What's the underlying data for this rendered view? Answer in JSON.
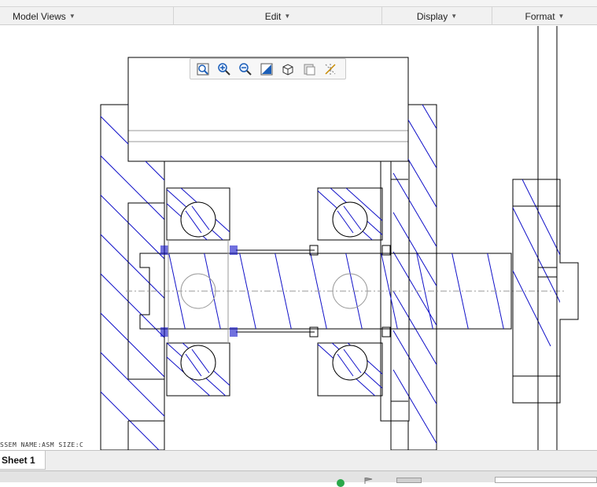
{
  "ribbon": {
    "groups": [
      {
        "label": "Model Views"
      },
      {
        "label": "Edit"
      },
      {
        "label": "Display"
      },
      {
        "label": "Format"
      }
    ]
  },
  "view_toolbar": {
    "buttons": [
      "refit-icon",
      "zoom-in-icon",
      "zoom-out-icon",
      "repaint-icon",
      "display-style-icon",
      "sheet-display-icon",
      "datum-display-icon"
    ]
  },
  "drawing": {
    "title_block_text": "SSEM   NAME:ASM   SIZE:C",
    "line_color": "#000000",
    "hatch_color": "#1010c8",
    "hidden_line_color": "#9a9a9a"
  },
  "sheets": {
    "active_tab": "Sheet 1"
  },
  "colors": {
    "ribbon_bg": "#f1f1f1",
    "status_ok": "#2aa84a"
  }
}
